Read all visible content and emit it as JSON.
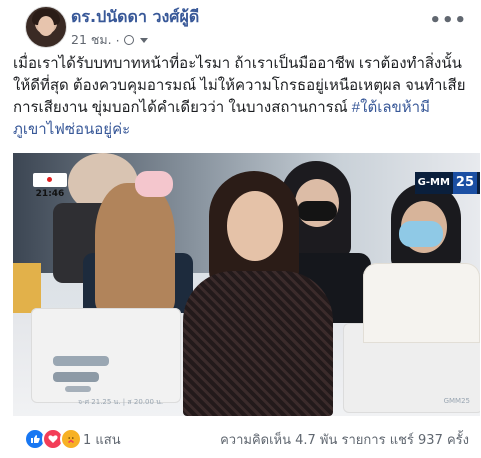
{
  "post": {
    "author": "ดร.ปนัดดา วงศ์ผู้ดี",
    "time": "21 ชม.",
    "privacy_icon": "globe-icon",
    "more_label": "•••",
    "text_main": "เมื่อเราได้รับบทบาทหน้าที่อะไรมา ถ้าเราเป็นมืออาชีพ เราต้องทำสิ่งนั้นให้ดีที่สุด ต้องควบคุมอารมณ์ ไม่ให้ความโกรธอยู่เหนือเหตุผล จนทำเสียการเสียงาน ขุ่มบอกได้คำเดียวว่า ในบางสถานการณ์ ",
    "hashtag": "#ใต้เลขห้ามีภูเขาไฟซ่อนอยู่ค่ะ"
  },
  "photo": {
    "live_badge": "21:46",
    "channel_name": "G-MM",
    "channel_number": "25",
    "caption_left": "จ-ศ 21.25 น. | ส 20.00 น.",
    "caption_right": "GMM25"
  },
  "stats": {
    "reaction_icons": [
      "like-icon",
      "love-icon",
      "care-icon"
    ],
    "reaction_count": "1 แสน",
    "comments_shares": "ความคิดเห็น 4.7 พัน รายการ  แชร์ 937 ครั้ง"
  },
  "colors": {
    "link_blue": "#385898",
    "like_blue": "#1877f2",
    "love_red": "#f33e58",
    "care_yellow": "#f7b125"
  }
}
